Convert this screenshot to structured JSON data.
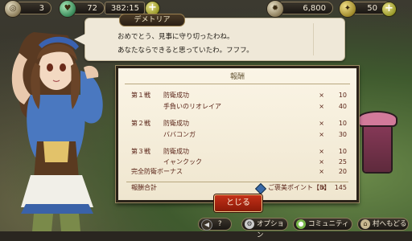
{
  "hud": {
    "stamina_level": "3",
    "hp_value": "72",
    "timer": "382:15",
    "gold": "6,800",
    "gems": "50"
  },
  "dialog": {
    "speaker": "デメトリア",
    "line1": "おめでとう、見事に守り切ったわね。",
    "line2": "あなたならできると思っていたわ。フフフ。"
  },
  "result": {
    "header": "報酬",
    "rows": [
      {
        "stage": "第１戦",
        "label": "防衛成功",
        "mult": "×",
        "value": "10"
      },
      {
        "stage": "",
        "label": "手負いのリオレイア",
        "mult": "×",
        "value": "40"
      },
      {
        "stage": "第２戦",
        "label": "防衛成功",
        "mult": "×",
        "value": "10"
      },
      {
        "stage": "",
        "label": "ババコンガ",
        "mult": "×",
        "value": "30"
      },
      {
        "stage": "第３戦",
        "label": "防衛成功",
        "mult": "×",
        "value": "10"
      },
      {
        "stage": "",
        "label": "イャンクック",
        "mult": "×",
        "value": "25"
      },
      {
        "stage": "",
        "label": "完全防衛ボーナス",
        "mult": "×",
        "value": "20"
      }
    ],
    "total_label": "報酬合計",
    "points_label": "ご褒美ポイント【B】",
    "total_mult": "×",
    "total_value": "145"
  },
  "close_button": "とじる",
  "bottom": {
    "help": "?",
    "option": "オプション",
    "community": "コミュニティ",
    "back": "村へもどる"
  },
  "colors": {
    "panel_bg": "#f6efdc",
    "result_text": "#5a2418",
    "close_button": "#b42814",
    "hud_dark": "#221e18"
  }
}
